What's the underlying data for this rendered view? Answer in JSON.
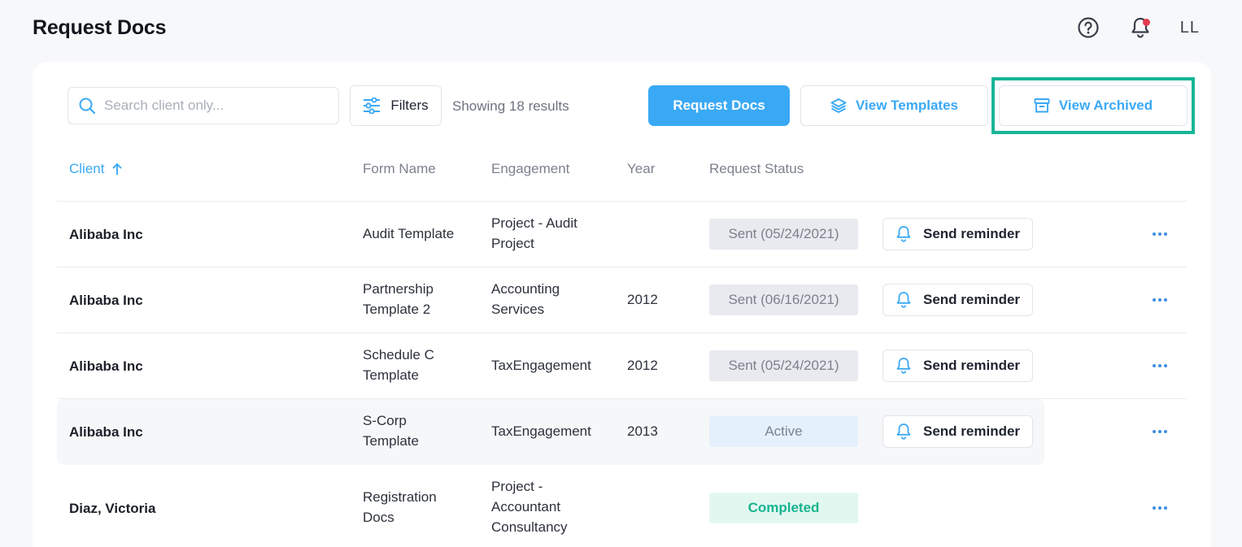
{
  "header": {
    "title": "Request Docs",
    "avatar_initials": "LL",
    "help_icon": "help-circle-icon",
    "notification_icon": "bell-icon"
  },
  "toolbar": {
    "search_placeholder": "Search client only...",
    "search_value": "",
    "filters_label": "Filters",
    "results_text": "Showing 18 results",
    "request_docs_label": "Request Docs",
    "view_templates_label": "View Templates",
    "view_archived_label": "View Archived"
  },
  "table": {
    "columns": {
      "client": "Client",
      "form_name": "Form Name",
      "engagement": "Engagement",
      "year": "Year",
      "request_status": "Request Status"
    },
    "rows": [
      {
        "client": "Alibaba Inc",
        "form_line1": "Audit Template",
        "form_line2": "",
        "eng_line1": "Project - Audit",
        "eng_line2": "Project",
        "eng_line3": "",
        "year": "",
        "status": "Sent (05/24/2021)",
        "status_type": "sent",
        "reminder": "Send reminder"
      },
      {
        "client": "Alibaba Inc",
        "form_line1": "Partnership",
        "form_line2": "Template 2",
        "eng_line1": "Accounting",
        "eng_line2": "Services",
        "eng_line3": "",
        "year": "2012",
        "status": "Sent (06/16/2021)",
        "status_type": "sent",
        "reminder": "Send reminder"
      },
      {
        "client": "Alibaba Inc",
        "form_line1": "Schedule C",
        "form_line2": "Template",
        "eng_line1": "TaxEngagement",
        "eng_line2": "",
        "eng_line3": "",
        "year": "2012",
        "status": "Sent (05/24/2021)",
        "status_type": "sent",
        "reminder": "Send reminder"
      },
      {
        "client": "Alibaba Inc",
        "form_line1": "S-Corp",
        "form_line2": "Template",
        "eng_line1": "TaxEngagement",
        "eng_line2": "",
        "eng_line3": "",
        "year": "2013",
        "status": "Active",
        "status_type": "active",
        "reminder": "Send reminder"
      },
      {
        "client": "Diaz, Victoria",
        "form_line1": "Registration",
        "form_line2": "Docs",
        "eng_line1": "Project -",
        "eng_line2": "Accountant",
        "eng_line3": "Consultancy",
        "year": "",
        "status": "Completed",
        "status_type": "completed",
        "reminder": ""
      }
    ]
  },
  "colors": {
    "accent": "#3aa9f5",
    "highlight_box": "#18b598",
    "completed": "#17b48f"
  }
}
